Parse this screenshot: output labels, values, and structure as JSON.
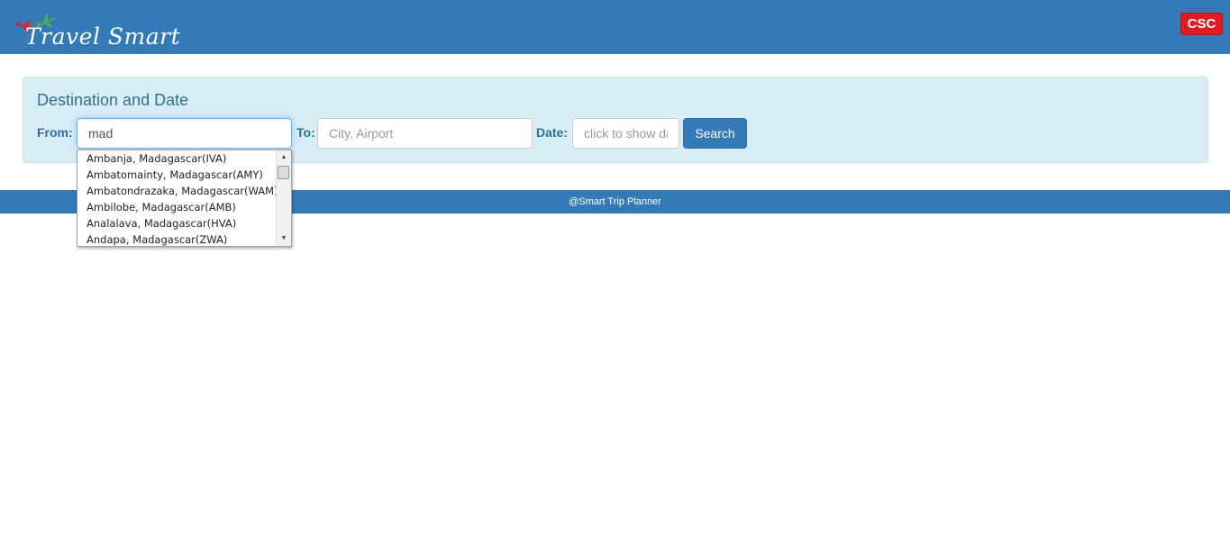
{
  "header": {
    "logo_text": "Travel Smart",
    "badge_text": "CSC",
    "brand_color": "#337ab7",
    "badge_color": "#e31c24"
  },
  "search_panel": {
    "title": "Destination and Date",
    "from_label": "From:",
    "from_value": "mad",
    "to_label": "To:",
    "to_placeholder": "City, Airport",
    "date_label": "Date:",
    "date_placeholder": "click to show date picker",
    "search_button": "Search"
  },
  "autocomplete": {
    "items": [
      "Ambanja, Madagascar(IVA)",
      "Ambatomainty, Madagascar(AMY)",
      "Ambatondrazaka, Madagascar(WAM)",
      "Ambilobe, Madagascar(AMB)",
      "Analalava, Madagascar(HVA)",
      "Andapa, Madagascar(ZWA)"
    ]
  },
  "footer": {
    "text": "@Smart Trip Planner"
  }
}
